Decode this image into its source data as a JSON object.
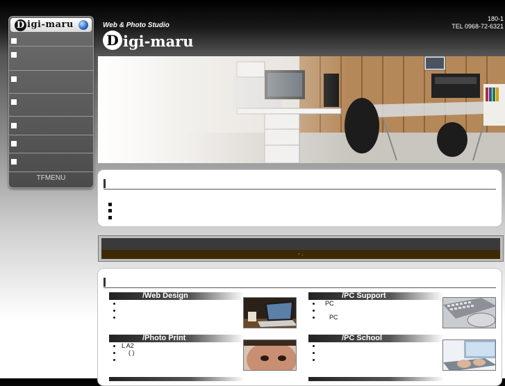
{
  "side_menu": {
    "logo_text": "igi-maru",
    "logo_initial": "D",
    "items": [
      {
        "label": ""
      },
      {
        "label": ""
      },
      {
        "label": ""
      },
      {
        "label": ""
      },
      {
        "label": ""
      },
      {
        "label": ""
      },
      {
        "label": ""
      }
    ],
    "footer_label": "TFMENU"
  },
  "header": {
    "tagline": "Web & Photo Studio",
    "brand_initial": "D",
    "brand_text": "igi-maru",
    "address_line": "180-1",
    "tel_line": "TEL 0968-72-6321"
  },
  "news": {
    "bar_text": "- ."
  },
  "services": [
    {
      "title": "/Web Design",
      "bullets": [
        "",
        "",
        ""
      ]
    },
    {
      "title": "/PC Support",
      "bullets": [
        "PC",
        "",
        "PC"
      ]
    },
    {
      "title": "/Photo Print",
      "bullets": [
        "L  A2",
        "( )",
        ""
      ]
    },
    {
      "title": "/PC School",
      "bullets": [
        "",
        "",
        ""
      ]
    }
  ],
  "colors": {
    "news_bar_bottom": "#3d2a05",
    "panel_border": "#c2c2c2"
  }
}
